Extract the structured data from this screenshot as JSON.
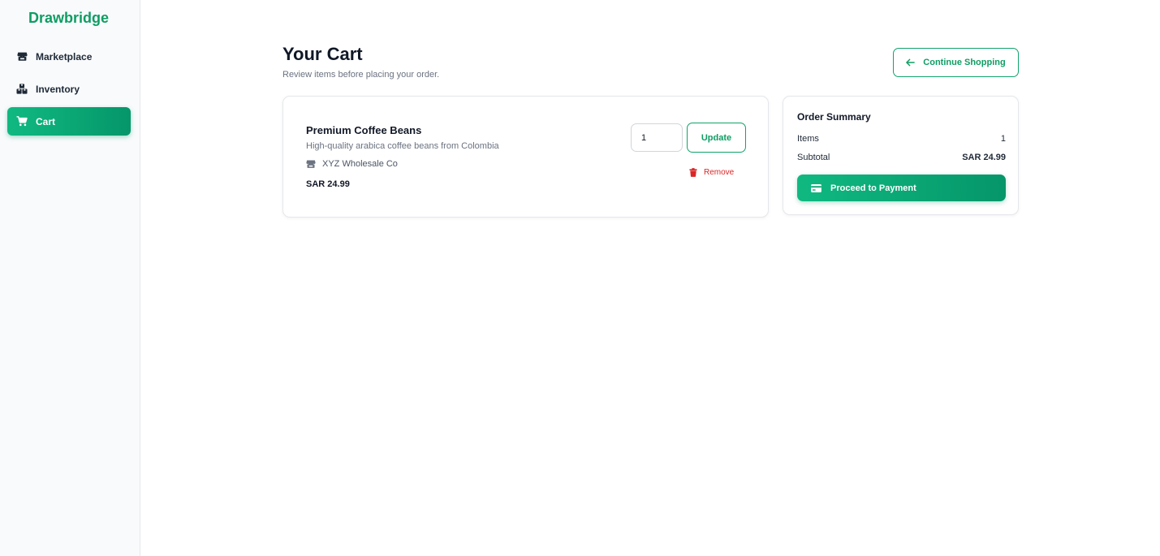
{
  "app": {
    "brand": "Drawbridge"
  },
  "sidebar": {
    "items": [
      {
        "label": "Marketplace",
        "icon": "store-icon",
        "active": false
      },
      {
        "label": "Inventory",
        "icon": "boxes-icon",
        "active": false
      },
      {
        "label": "Cart",
        "icon": "cart-icon",
        "active": true
      }
    ]
  },
  "header": {
    "title": "Your Cart",
    "subtitle": "Review items before placing your order.",
    "continue_label": "Continue Shopping"
  },
  "cart": {
    "items": [
      {
        "name": "Premium Coffee Beans",
        "description": "High-quality arabica coffee beans from Colombia",
        "seller": "XYZ Wholesale Co",
        "price": "SAR 24.99",
        "quantity": "1",
        "update_label": "Update",
        "remove_label": "Remove"
      }
    ]
  },
  "summary": {
    "title": "Order Summary",
    "items_label": "Items",
    "items_value": "1",
    "subtotal_label": "Subtotal",
    "subtotal_value": "SAR 24.99",
    "pay_label": "Proceed to Payment"
  },
  "colors": {
    "accent": "#10b981",
    "accent_dark": "#059669",
    "danger": "#dc2626"
  }
}
